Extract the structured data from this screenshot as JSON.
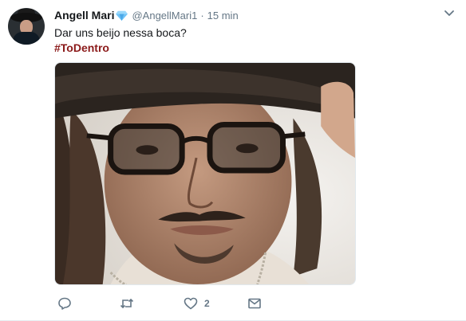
{
  "tweet": {
    "author_name": "Angell Mari",
    "handle": "@AngellMari1",
    "separator": "·",
    "time": "15 min",
    "text": "Dar uns beijo nessa boca?",
    "hashtag": "#ToDentro",
    "verified_icon": "blue-diamond-emoji",
    "caret_icon": "chevron-down-icon",
    "hashtag_color": "#8b1a1a"
  },
  "actions": {
    "reply": {
      "icon": "reply-icon",
      "count": ""
    },
    "retweet": {
      "icon": "retweet-icon",
      "count": ""
    },
    "like": {
      "icon": "heart-icon",
      "count": "2"
    },
    "message": {
      "icon": "envelope-icon",
      "count": ""
    }
  },
  "colors": {
    "name": "#14171a",
    "meta": "#657786",
    "action_icon": "#657786"
  }
}
